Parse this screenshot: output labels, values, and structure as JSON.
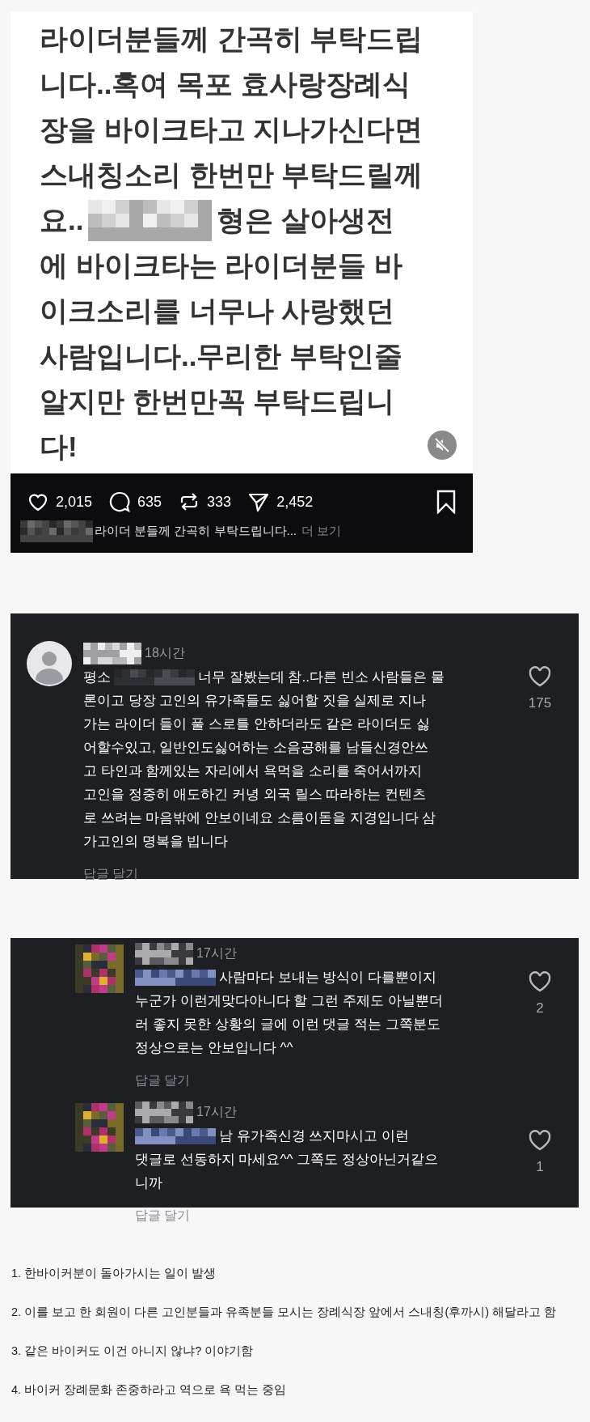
{
  "post": {
    "lines": [
      {
        "text": "라이더분들께 간곡히 부탁드립"
      },
      {
        "text": "니다..혹여 목포 효사랑장례식"
      },
      {
        "text": "장을 바이크타고 지나가신다면"
      },
      {
        "text": "스내칭소리 한번만 부탁드릴께"
      },
      {
        "text": "요..",
        "redacted": true,
        "after": "형은 살아생전"
      },
      {
        "text": "에 바이크타는 라이더분들 바"
      },
      {
        "text": "이크소리를 너무나 사랑했던"
      },
      {
        "text": "사람입니다..무리한 부탁인줄"
      },
      {
        "text": "알지만 한번만꼭 부탁드립니"
      },
      {
        "text": "다!"
      }
    ],
    "muted": true,
    "stats": [
      {
        "kind": "like",
        "count": "2,015"
      },
      {
        "kind": "comment",
        "count": "635"
      },
      {
        "kind": "repost",
        "count": "333"
      },
      {
        "kind": "share",
        "count": "2,452"
      }
    ],
    "caption": "라이더 분들께 간곡히 부탁드립니다...",
    "more": "더 보기"
  },
  "comment_threads": [
    {
      "comments": [
        {
          "kind": "comment",
          "time": "18시간",
          "lead": "평소",
          "redacted_mention": true,
          "lines": [
            "너무 잘봤는데 참..다른 빈소 사람들은 물",
            "론이고  당장 고인의 유가족들도 싫어할 짓을 실제로 지나",
            "가는 라이더 들이  풀 스로틀 안하더라도 같은 라이더도 싫",
            "어할수있고, 일반인도싫어하는  소음공해를 남들신경안쓰",
            "고 타인과 함께있는 자리에서 욕먹을 소리를 죽어서까지",
            "고인을 정중히 애도하긴 커녕 외국 릴스 따라하는 컨텐츠",
            "로 쓰려는 마음밖에 안보이네요 소름이돋을 지경입니다 삼",
            "가고인의 명복을 빕니다"
          ],
          "likes": "175",
          "reply": "답글 달기"
        }
      ]
    },
    {
      "comments": [
        {
          "kind": "reply",
          "time": "17시간",
          "redacted_mention": true,
          "lines": [
            "사람마다 보내는 방식이 다를뿐이지",
            "누군가 이런게맞다아니다 할 그런 주제도 아닐뿐더",
            "러 좋지 못한 상황의 글에 이런 댓글 적는 그쪽분도",
            "정상으로는 안보입니다 ^^"
          ],
          "likes": "2",
          "reply": "답글 달기"
        },
        {
          "kind": "reply",
          "time": "17시간",
          "redacted_mention": true,
          "lines": [
            "남 유가족신경 쓰지마시고 이런",
            "댓글로 선동하지 마세요^^ 그쪽도 정상아닌거같으",
            "니까"
          ],
          "likes": "1",
          "reply": "답글 달기"
        }
      ]
    }
  ],
  "summary": [
    "1. 한바이커분이 돌아가시는 일이 발생",
    "2. 이를 보고 한 회원이 다른 고인분들과 유족분들 모시는 장례식장 앞에서 스내칭(후까시) 해달라고 함",
    "3. 같은 바이커도 이건 아니지 않냐? 이야기함",
    "4. 바이커 장례문화 존중하라고 역으로 욕 먹는 중임"
  ]
}
